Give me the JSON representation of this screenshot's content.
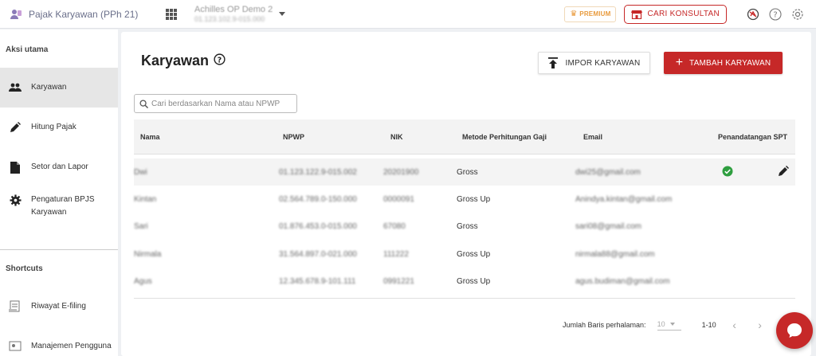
{
  "header": {
    "app_name": "Pajak Karyawan (PPh 21)",
    "company_name": "Achilles OP Demo 2",
    "company_npwp": "01.123.102.9-015.000",
    "premium_label": "PREMIUM",
    "konsultan_label": "CARI KONSULTAN",
    "icons": [
      "grid-apps-icon",
      "badge-icon",
      "help-icon",
      "gear-icon"
    ]
  },
  "sidebar": {
    "section_main": "Aksi utama",
    "items": [
      {
        "label": "Karyawan",
        "icon": "people-icon"
      },
      {
        "label": "Hitung Pajak",
        "icon": "pencil-icon"
      },
      {
        "label": "Setor dan Lapor",
        "icon": "document-icon"
      },
      {
        "label": "Pengaturan BPJS Karyawan",
        "icon": "gear-icon"
      }
    ],
    "section_shortcuts": "Shortcuts",
    "shortcuts": [
      {
        "label": "Riwayat E-filing",
        "icon": "efiling-icon"
      },
      {
        "label": "Manajemen Pengguna",
        "icon": "users-manage-icon"
      }
    ]
  },
  "main": {
    "title": "Karyawan",
    "impor_label": "IMPOR KARYAWAN",
    "tambah_label": "TAMBAH KARYAWAN",
    "search_placeholder": "Cari berdasarkan Nama atau NPWP",
    "columns": [
      "Nama",
      "NPWP",
      "NIK",
      "Metode Perhitungan Gaji",
      "Email",
      "Penandatangan SPT"
    ],
    "rows": [
      {
        "nama": "Dwi",
        "npwp": "01.123.122.9-015.002",
        "nik": "20201900",
        "metode": "Gross",
        "email": "dwi25@gmail.com",
        "penandatangan": true
      },
      {
        "nama": "Kintan",
        "npwp": "02.564.789.0-150.000",
        "nik": "0000091",
        "metode": "Gross Up",
        "email": "Anindya.kintan@gmail.com",
        "penandatangan": false
      },
      {
        "nama": "Sari",
        "npwp": "01.876.453.0-015.000",
        "nik": "67080",
        "metode": "Gross",
        "email": "sari08@gmail.com",
        "penandatangan": false
      },
      {
        "nama": "Nirmala",
        "npwp": "31.564.897.0-021.000",
        "nik": "111222",
        "metode": "Gross Up",
        "email": "nirmala88@gmail.com",
        "penandatangan": false
      },
      {
        "nama": "Agus",
        "npwp": "12.345.678.9-101.111",
        "nik": "0991221",
        "metode": "Gross Up",
        "email": "agus.budiman@gmail.com",
        "penandatangan": false
      }
    ],
    "pager": {
      "rows_label": "Jumlah Baris perhalaman:",
      "rows_value": "10",
      "range": "1-10",
      "prev": "‹",
      "next": "›"
    }
  },
  "colors": {
    "accent": "#c62828",
    "premium": "#e89a3c",
    "check": "#2e9e3f"
  }
}
